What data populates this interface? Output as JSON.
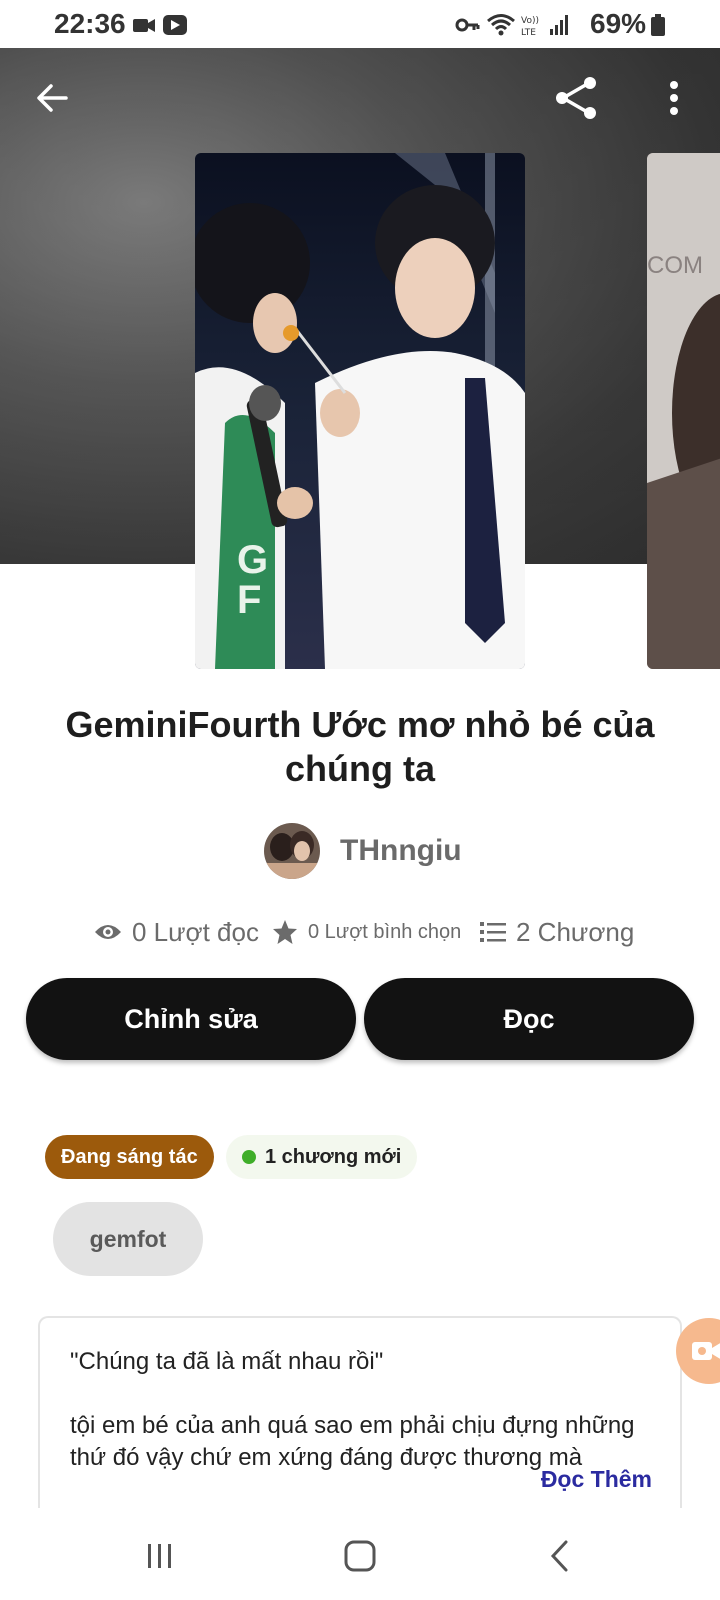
{
  "status_bar": {
    "time": "22:36",
    "battery": "69%",
    "icons": [
      "video-camera-icon",
      "screen-record-icon",
      "vpn-key-icon",
      "wifi-icon",
      "volte-icon",
      "signal-icon",
      "battery-icon"
    ]
  },
  "header": {
    "back_icon": "back-arrow-icon",
    "share_icon": "share-icon",
    "menu_icon": "more-vertical-icon"
  },
  "story": {
    "title": "GeminiFourth  Ước mơ nhỏ bé của chúng ta",
    "author": "THnngiu",
    "stats": {
      "reads": "0 Lượt đọc",
      "votes": "0 Lượt bình chọn",
      "chapters": "2 Chương"
    },
    "edit_label": "Chỉnh sửa",
    "read_label": "Đọc",
    "status_badge": "Đang sáng tác",
    "new_badge": "1 chương mới",
    "tag": "gemfot",
    "description": [
      "\"Chúng ta đã là mất nhau rồi\"",
      "tội em bé của anh quá sao em phải chịu đựng những",
      "thứ đó vậy chứ em xứng đáng được thương mà"
    ],
    "read_more": "Đọc Thêm"
  },
  "colors": {
    "status_badge": "#9c5a0c",
    "new_dot": "#3fae29",
    "read_more": "#2b2ba0",
    "button_bg": "#121212"
  }
}
